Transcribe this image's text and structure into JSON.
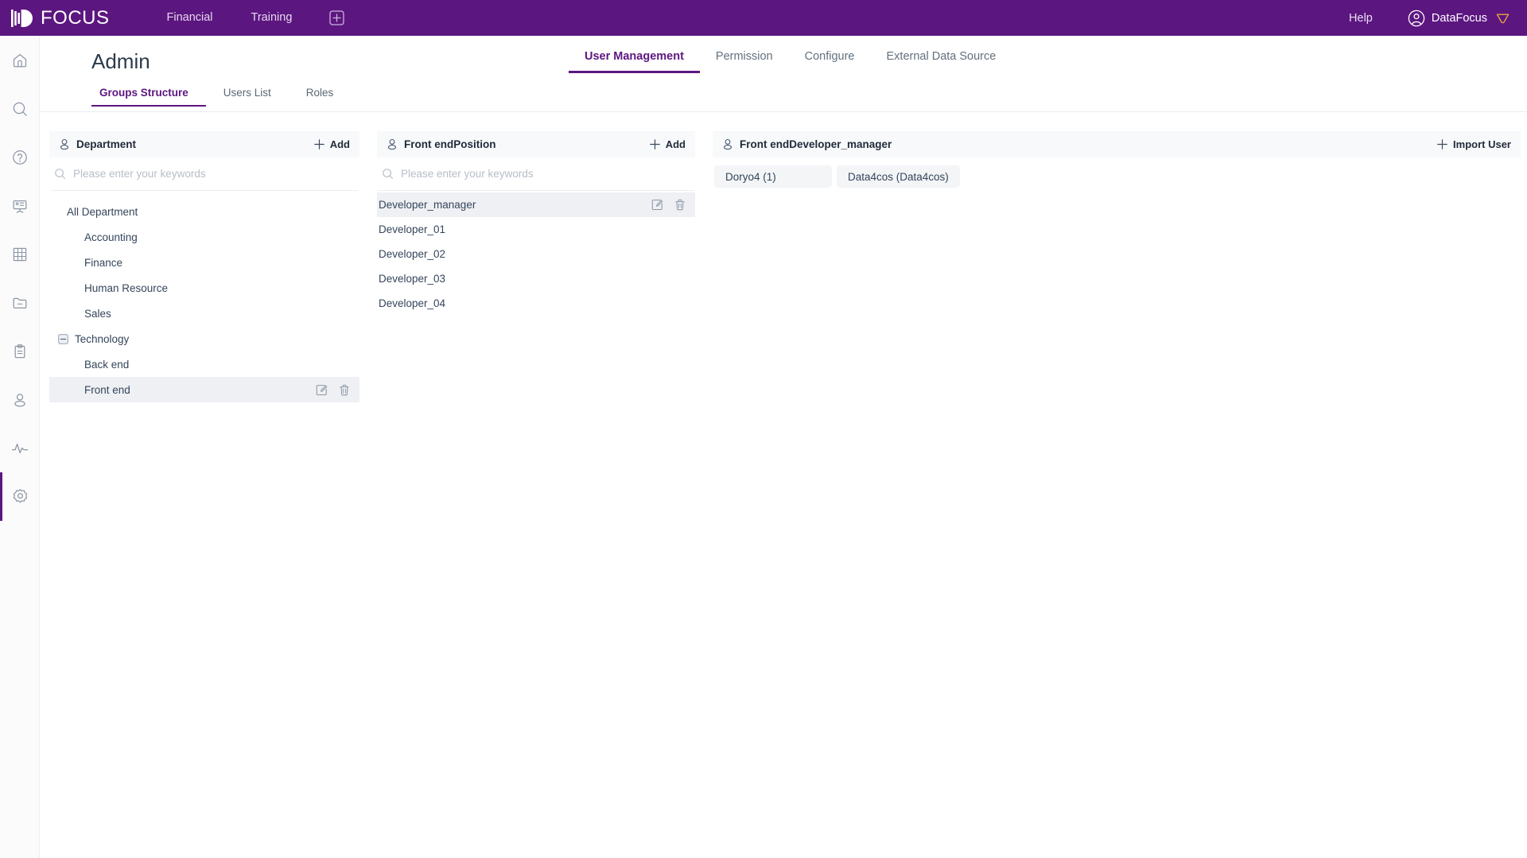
{
  "header": {
    "logo_text": "FOCUS",
    "logo_icon": "focus-logo-icon",
    "nav": [
      {
        "label": "Financial",
        "name": "topnav-financial"
      },
      {
        "label": "Training",
        "name": "topnav-training"
      }
    ],
    "add_icon": "plus-square-icon",
    "help_label": "Help",
    "user_name": "DataFocus",
    "avatar_icon": "user-circle-icon",
    "crown_icon": "crown-icon",
    "background_color": "#5c1680"
  },
  "sidebar": {
    "items": [
      {
        "name": "sidebar-item-home",
        "icon": "home-icon",
        "active": false
      },
      {
        "name": "sidebar-item-search",
        "icon": "search-icon",
        "active": false
      },
      {
        "name": "sidebar-item-help",
        "icon": "question-icon",
        "active": false
      },
      {
        "name": "sidebar-item-dashboard",
        "icon": "monitor-icon",
        "active": false
      },
      {
        "name": "sidebar-item-table",
        "icon": "grid-icon",
        "active": false
      },
      {
        "name": "sidebar-item-folder",
        "icon": "folder-icon",
        "active": false
      },
      {
        "name": "sidebar-item-clipboard",
        "icon": "clipboard-icon",
        "active": false
      },
      {
        "name": "sidebar-item-user",
        "icon": "user-icon",
        "active": false
      },
      {
        "name": "sidebar-item-activity",
        "icon": "activity-icon",
        "active": false
      },
      {
        "name": "sidebar-item-settings",
        "icon": "gear-icon",
        "active": true
      }
    ],
    "active_color": "#5c1680"
  },
  "page": {
    "title": "Admin",
    "accent_color": "#5c1680"
  },
  "section_tabs": [
    {
      "label": "User Management",
      "active": true
    },
    {
      "label": "Permission",
      "active": false
    },
    {
      "label": "Configure",
      "active": false
    },
    {
      "label": "External Data Source",
      "active": false
    }
  ],
  "sub_tabs": [
    {
      "label": "Groups Structure",
      "active": true
    },
    {
      "label": "Users List",
      "active": false
    },
    {
      "label": "Roles",
      "active": false
    }
  ],
  "department_panel": {
    "icon": "person-outline-icon",
    "title": "Department",
    "add_label": "Add",
    "add_icon": "plus-icon",
    "search_placeholder": "Please enter your keywords",
    "search_value": "",
    "search_icon": "search-icon",
    "tree": [
      {
        "label": "All Department",
        "level": 0,
        "toggle": "",
        "selected": false
      },
      {
        "label": "Accounting",
        "level": 1,
        "toggle": "",
        "selected": false
      },
      {
        "label": "Finance",
        "level": 1,
        "toggle": "",
        "selected": false
      },
      {
        "label": "Human Resource",
        "level": 1,
        "toggle": "",
        "selected": false
      },
      {
        "label": "Sales",
        "level": 1,
        "toggle": "",
        "selected": false
      },
      {
        "label": "Technology",
        "level": 0,
        "toggle": "minus-square-icon",
        "selected": false
      },
      {
        "label": "Back end",
        "level": 2,
        "toggle": "",
        "selected": false
      },
      {
        "label": "Front end",
        "level": 2,
        "toggle": "",
        "selected": true
      }
    ],
    "row_edit_icon": "edit-icon",
    "row_delete_icon": "trash-icon"
  },
  "position_panel": {
    "icon": "person-outline-icon",
    "title": "Front endPosition",
    "add_label": "Add",
    "add_icon": "plus-icon",
    "search_placeholder": "Please enter your keywords",
    "search_value": "",
    "search_icon": "search-icon",
    "items": [
      {
        "label": "Developer_manager",
        "selected": true
      },
      {
        "label": "Developer_01",
        "selected": false
      },
      {
        "label": "Developer_02",
        "selected": false
      },
      {
        "label": "Developer_03",
        "selected": false
      },
      {
        "label": "Developer_04",
        "selected": false
      }
    ],
    "row_edit_icon": "edit-icon",
    "row_delete_icon": "trash-icon"
  },
  "user_panel": {
    "icon": "person-outline-icon",
    "title": "Front endDeveloper_manager",
    "import_label": "Import User",
    "import_icon": "plus-icon",
    "users": [
      {
        "label": "Doryo4 (1)"
      },
      {
        "label": "Data4cos (Data4cos)"
      }
    ]
  }
}
